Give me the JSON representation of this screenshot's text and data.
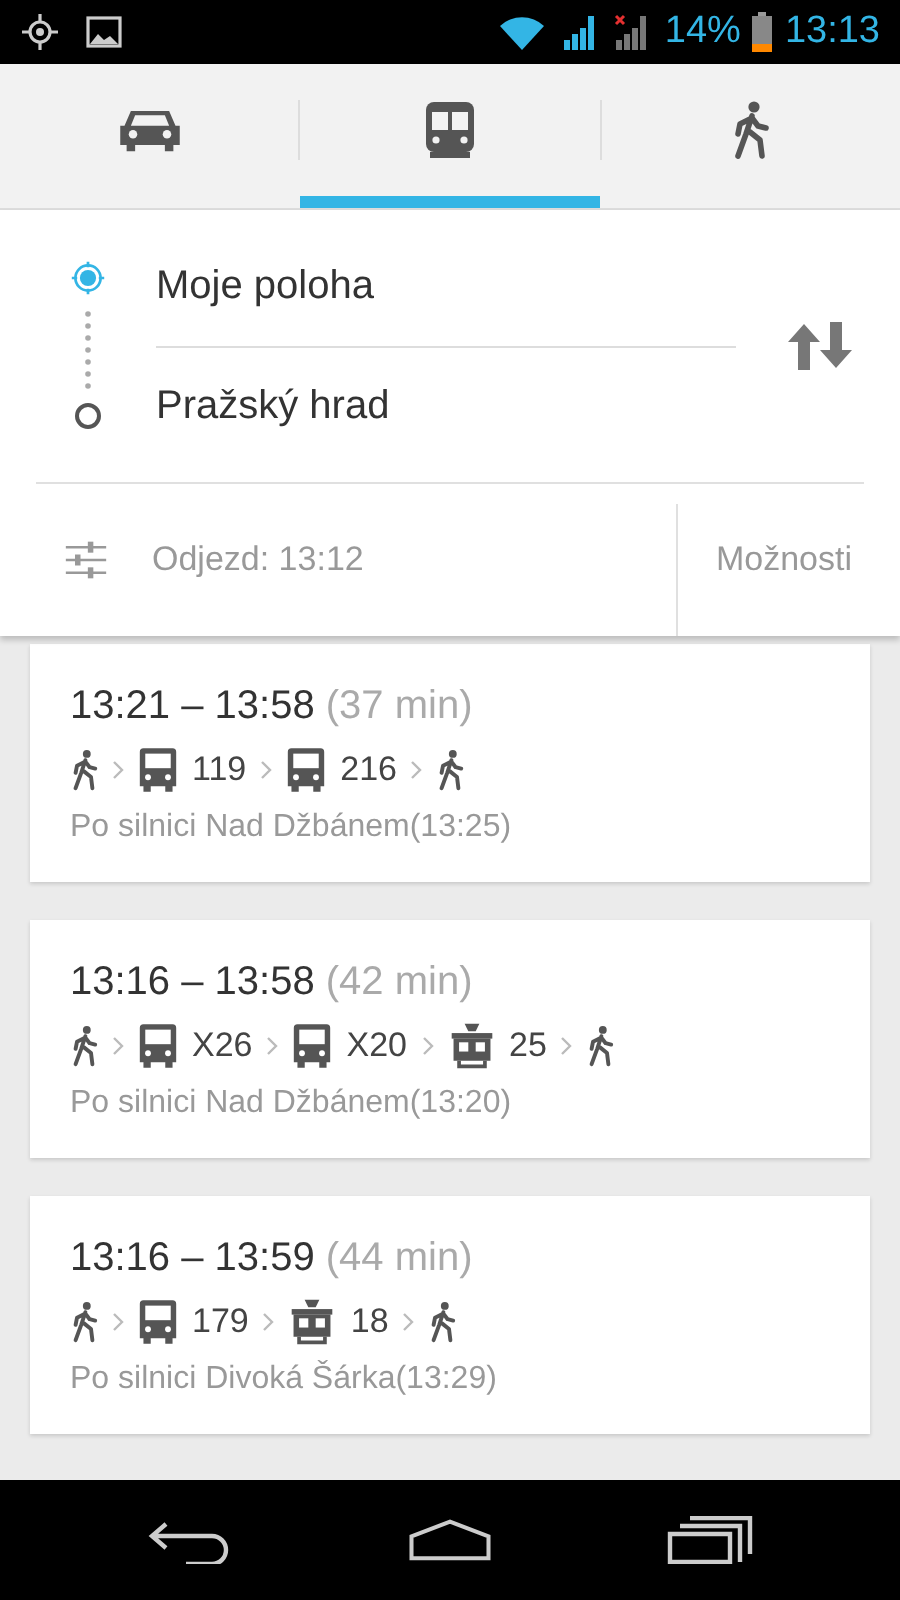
{
  "status_bar": {
    "battery_text": "14%",
    "time": "13:13"
  },
  "tabs": [
    {
      "kind": "car",
      "selected": false
    },
    {
      "kind": "transit",
      "selected": true
    },
    {
      "kind": "walk",
      "selected": false
    }
  ],
  "route": {
    "origin": "Moje poloha",
    "destination": "Pražský hrad"
  },
  "options": {
    "departure": "Odjezd: 13:12",
    "button": "Možnosti"
  },
  "results": [
    {
      "times": "13:21 – 13:58",
      "duration": "(37 min)",
      "steps": [
        {
          "kind": "walk"
        },
        {
          "kind": "bus",
          "label": "119"
        },
        {
          "kind": "bus",
          "label": "216"
        },
        {
          "kind": "walk"
        }
      ],
      "via": "Po silnici Nad Džbánem(13:25)"
    },
    {
      "times": "13:16 – 13:58",
      "duration": "(42 min)",
      "steps": [
        {
          "kind": "walk"
        },
        {
          "kind": "bus",
          "label": "X26"
        },
        {
          "kind": "bus",
          "label": "X20"
        },
        {
          "kind": "tram",
          "label": "25"
        },
        {
          "kind": "walk"
        }
      ],
      "via": "Po silnici Nad Džbánem(13:20)"
    },
    {
      "times": "13:16 – 13:59",
      "duration": "(44 min)",
      "steps": [
        {
          "kind": "walk"
        },
        {
          "kind": "bus",
          "label": "179"
        },
        {
          "kind": "tram",
          "label": "18"
        },
        {
          "kind": "walk"
        }
      ],
      "via": "Po silnici Divoká Šárka(13:29)"
    }
  ]
}
